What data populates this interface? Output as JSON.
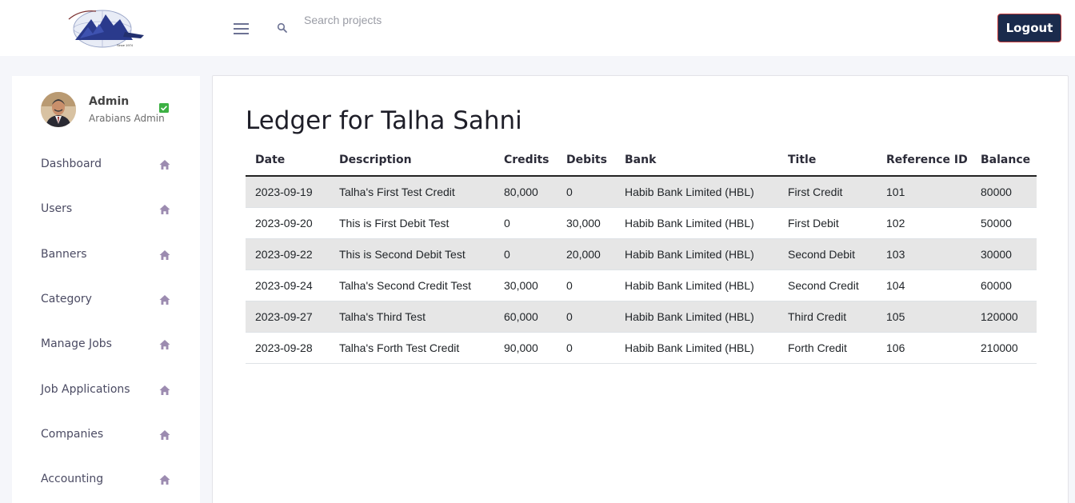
{
  "header": {
    "search_placeholder": "Search projects",
    "logout_label": "Logout",
    "logo_icon": "organization-logo-globe",
    "menu_icon": "hamburger-menu-icon",
    "search_icon": "search-icon"
  },
  "profile": {
    "name": "Admin",
    "role": "Arabians Admin",
    "verified_icon": "check-badge-icon"
  },
  "sidebar": {
    "items": [
      {
        "label": "Dashboard",
        "icon": "home-icon"
      },
      {
        "label": "Users",
        "icon": "home-icon"
      },
      {
        "label": "Banners",
        "icon": "home-icon"
      },
      {
        "label": "Category",
        "icon": "home-icon"
      },
      {
        "label": "Manage Jobs",
        "icon": "home-icon"
      },
      {
        "label": "Job Applications",
        "icon": "home-icon"
      },
      {
        "label": "Companies",
        "icon": "home-icon"
      },
      {
        "label": "Accounting",
        "icon": "home-icon"
      }
    ]
  },
  "main": {
    "title": "Ledger for Talha Sahni",
    "columns": [
      "Date",
      "Description",
      "Credits",
      "Debits",
      "Bank",
      "Title",
      "Reference ID",
      "Balance"
    ],
    "rows": [
      [
        "2023-09-19",
        "Talha's First Test Credit",
        "80,000",
        "0",
        "Habib Bank Limited (HBL)",
        "First Credit",
        "101",
        "80000"
      ],
      [
        "2023-09-20",
        "This is First Debit Test",
        "0",
        "30,000",
        "Habib Bank Limited (HBL)",
        "First Debit",
        "102",
        "50000"
      ],
      [
        "2023-09-22",
        "This is Second Debit Test",
        "0",
        "20,000",
        "Habib Bank Limited (HBL)",
        "Second Debit",
        "103",
        "30000"
      ],
      [
        "2023-09-24",
        "Talha's Second Credit Test",
        "30,000",
        "0",
        "Habib Bank Limited (HBL)",
        "Second Credit",
        "104",
        "60000"
      ],
      [
        "2023-09-27",
        "Talha's Third Test",
        "60,000",
        "0",
        "Habib Bank Limited (HBL)",
        "Third Credit",
        "105",
        "120000"
      ],
      [
        "2023-09-28",
        "Talha's Forth Test Credit",
        "90,000",
        "0",
        "Habib Bank Limited (HBL)",
        "Forth Credit",
        "106",
        "210000"
      ]
    ]
  },
  "colors": {
    "logout_bg": "#1a2b4c",
    "nav_icon": "#9c8bb0",
    "verified": "#3cb043",
    "stripe": "#e6e6e6"
  }
}
